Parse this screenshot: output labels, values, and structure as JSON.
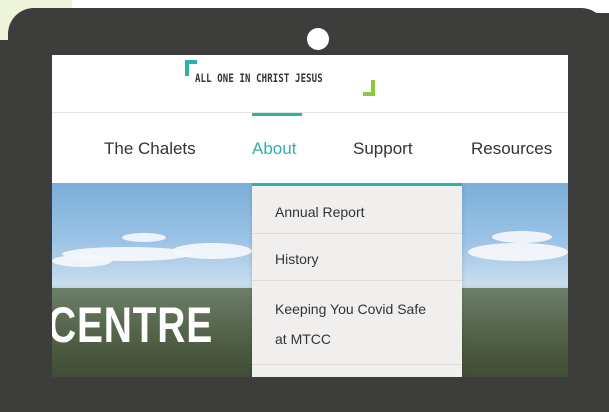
{
  "logo": {
    "text": "ALL ONE IN CHRIST JESUS"
  },
  "nav": {
    "items": [
      {
        "label": "The Chalets",
        "active": false
      },
      {
        "label": "About",
        "active": true
      },
      {
        "label": "Support",
        "active": false
      },
      {
        "label": "Resources",
        "active": false
      }
    ]
  },
  "hero": {
    "text": "CENTRE"
  },
  "about_menu": {
    "items": [
      {
        "label": "Annual Report"
      },
      {
        "label": "History"
      },
      {
        "label": "Keeping You Covid Safe at MTCC"
      }
    ]
  },
  "colors": {
    "accent_teal": "#2bb3a8",
    "accent_green": "#8dc63f",
    "device_frame": "#3d3e3c",
    "dropdown_bg": "#f1efee"
  }
}
